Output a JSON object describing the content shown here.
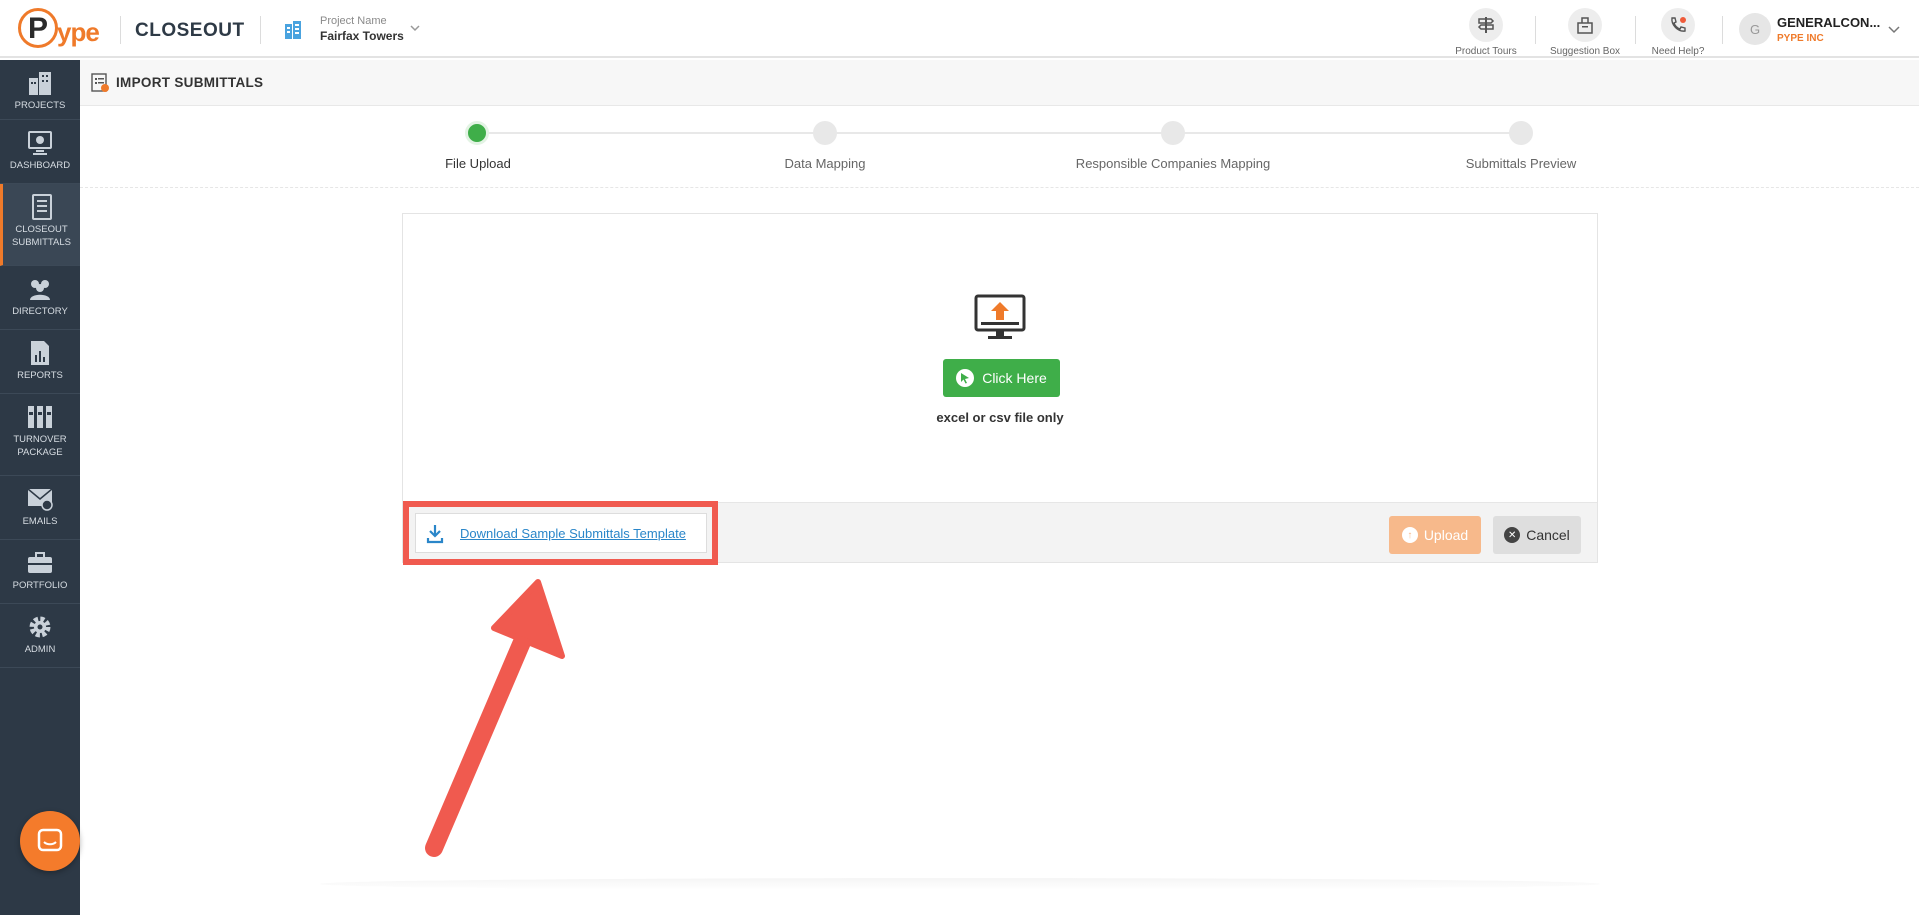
{
  "brand": {
    "logo_text": "ype",
    "accent": "#ef7a2a"
  },
  "header": {
    "module_title": "CLOSEOUT",
    "project_label": "Project Name",
    "project_name": "Fairfax Towers",
    "tools": [
      {
        "label": "Product Tours",
        "icon": "signpost-icon"
      },
      {
        "label": "Suggestion Box",
        "icon": "suggestion-box-icon"
      },
      {
        "label": "Need Help?",
        "icon": "phone-help-icon"
      }
    ],
    "user": {
      "initial": "G",
      "name": "GENERALCON...",
      "company": "PYPE INC"
    }
  },
  "sidebar": {
    "items": [
      {
        "label": "PROJECTS",
        "icon": "buildings-icon"
      },
      {
        "label": "DASHBOARD",
        "icon": "dashboard-icon"
      },
      {
        "label": "CLOSEOUT SUBMITTALS",
        "icon": "document-list-icon",
        "active": true
      },
      {
        "label": "DIRECTORY",
        "icon": "people-icon"
      },
      {
        "label": "REPORTS",
        "icon": "reports-icon"
      },
      {
        "label": "TURNOVER PACKAGE",
        "icon": "binders-icon"
      },
      {
        "label": "EMAILS",
        "icon": "email-icon"
      },
      {
        "label": "PORTFOLIO",
        "icon": "briefcase-icon"
      },
      {
        "label": "ADMIN",
        "icon": "gear-icon"
      }
    ]
  },
  "page": {
    "title": "IMPORT SUBMITTALS"
  },
  "stepper": {
    "steps": [
      {
        "label": "File Upload",
        "status": "done"
      },
      {
        "label": "Data Mapping",
        "status": "pending"
      },
      {
        "label": "Responsible Companies Mapping",
        "status": "pending"
      },
      {
        "label": "Submittals Preview",
        "status": "pending"
      }
    ]
  },
  "upload": {
    "click_label": "Click Here",
    "file_note": "excel or csv file only",
    "download_link": "Download Sample Submittals Template",
    "upload_label": "Upload",
    "cancel_label": "Cancel"
  },
  "colors": {
    "sidebar_bg": "#2d3946",
    "success": "#3fae49",
    "upload_btn": "#f7b98b",
    "annotation": "#f05a4f",
    "link": "#2a86c9"
  }
}
